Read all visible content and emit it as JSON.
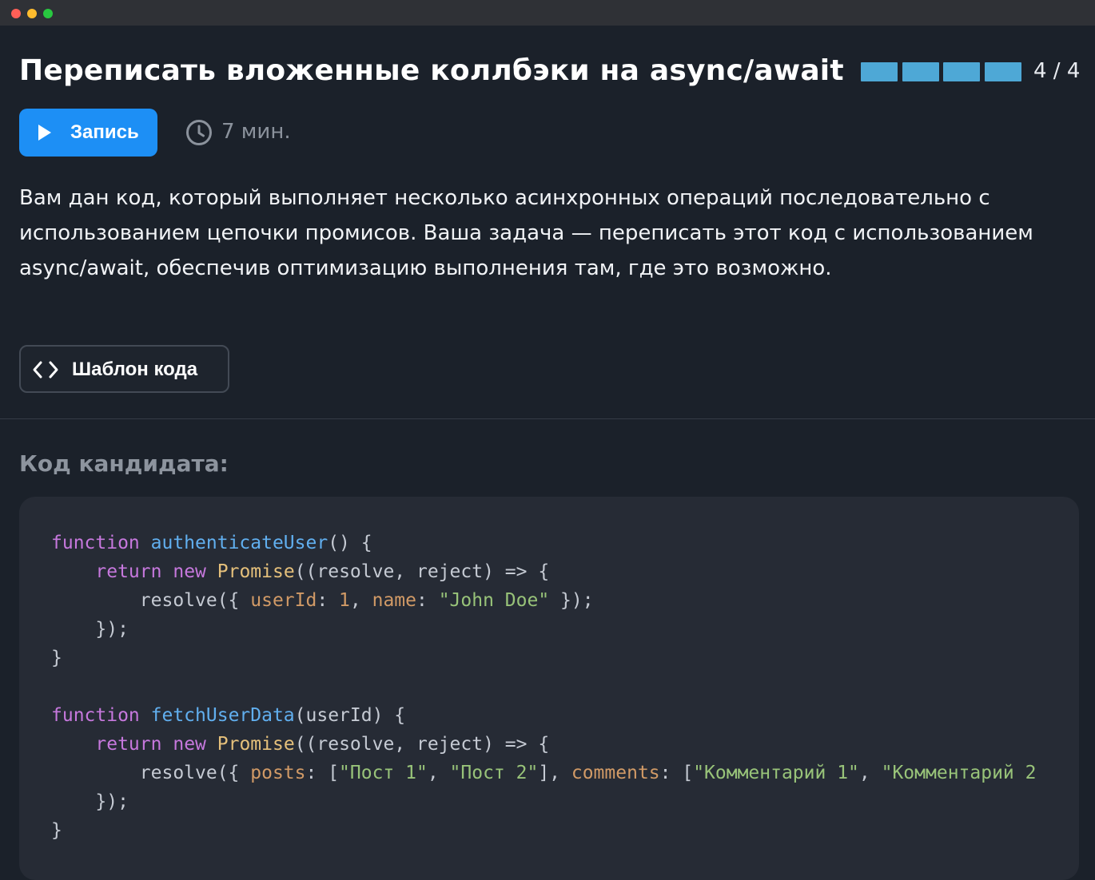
{
  "window": {
    "controls": [
      "close",
      "minimize",
      "maximize"
    ],
    "colors": {
      "close": "#ff5f57",
      "minimize": "#febc2e",
      "maximize": "#28c840"
    }
  },
  "task": {
    "title": "Переписать вложенные коллбэки на async/await",
    "progress": {
      "current": 4,
      "total": 4,
      "label": "4 / 4",
      "color": "#4ea8d6"
    },
    "record_button_label": "Запись",
    "duration": "7 мин.",
    "description": "Вам дан код, который выполняет несколько асинхронных операций последовательно с использованием цепочки промисов. Ваша задача — переписать этот код с использованием async/await, обеспечив оптимизацию выполнения там, где это возможно.",
    "template_button_label": "Шаблон кода"
  },
  "candidate": {
    "heading": "Код кандидата:",
    "code_lines": [
      [
        {
          "t": "keyword",
          "v": "function"
        },
        {
          "t": "plain",
          "v": " "
        },
        {
          "t": "func",
          "v": "authenticateUser"
        },
        {
          "t": "plain",
          "v": "() {"
        }
      ],
      [
        {
          "t": "plain",
          "v": "    "
        },
        {
          "t": "keyword",
          "v": "return"
        },
        {
          "t": "plain",
          "v": " "
        },
        {
          "t": "keyword",
          "v": "new"
        },
        {
          "t": "plain",
          "v": " "
        },
        {
          "t": "class",
          "v": "Promise"
        },
        {
          "t": "plain",
          "v": "((resolve, reject) => {"
        }
      ],
      [
        {
          "t": "plain",
          "v": "        resolve({ "
        },
        {
          "t": "prop",
          "v": "userId"
        },
        {
          "t": "plain",
          "v": ": "
        },
        {
          "t": "number",
          "v": "1"
        },
        {
          "t": "plain",
          "v": ", "
        },
        {
          "t": "prop",
          "v": "name"
        },
        {
          "t": "plain",
          "v": ": "
        },
        {
          "t": "string",
          "v": "\"John Doe\""
        },
        {
          "t": "plain",
          "v": " });"
        }
      ],
      [
        {
          "t": "plain",
          "v": "    });"
        }
      ],
      [
        {
          "t": "plain",
          "v": "}"
        }
      ],
      [
        {
          "t": "plain",
          "v": ""
        }
      ],
      [
        {
          "t": "keyword",
          "v": "function"
        },
        {
          "t": "plain",
          "v": " "
        },
        {
          "t": "func",
          "v": "fetchUserData"
        },
        {
          "t": "plain",
          "v": "(userId) {"
        }
      ],
      [
        {
          "t": "plain",
          "v": "    "
        },
        {
          "t": "keyword",
          "v": "return"
        },
        {
          "t": "plain",
          "v": " "
        },
        {
          "t": "keyword",
          "v": "new"
        },
        {
          "t": "plain",
          "v": " "
        },
        {
          "t": "class",
          "v": "Promise"
        },
        {
          "t": "plain",
          "v": "((resolve, reject) => {"
        }
      ],
      [
        {
          "t": "plain",
          "v": "        resolve({ "
        },
        {
          "t": "prop",
          "v": "posts"
        },
        {
          "t": "plain",
          "v": ": ["
        },
        {
          "t": "string",
          "v": "\"Пост 1\""
        },
        {
          "t": "plain",
          "v": ", "
        },
        {
          "t": "string",
          "v": "\"Пост 2\""
        },
        {
          "t": "plain",
          "v": "], "
        },
        {
          "t": "prop",
          "v": "comments"
        },
        {
          "t": "plain",
          "v": ": ["
        },
        {
          "t": "string",
          "v": "\"Комментарий 1\""
        },
        {
          "t": "plain",
          "v": ", "
        },
        {
          "t": "string",
          "v": "\"Комментарий 2"
        }
      ],
      [
        {
          "t": "plain",
          "v": "    });"
        }
      ],
      [
        {
          "t": "plain",
          "v": "}"
        }
      ]
    ]
  }
}
